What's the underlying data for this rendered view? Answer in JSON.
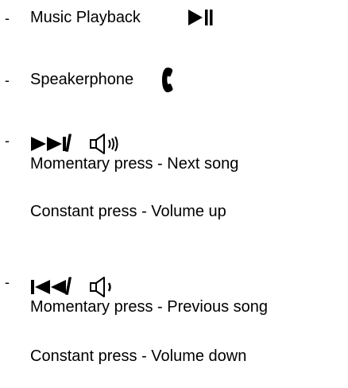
{
  "items": [
    {
      "bullet": "-",
      "label": "Music Playback",
      "icon": "play-pause-icon"
    },
    {
      "bullet": "-",
      "label": "Speakerphone",
      "icon": "phone-handset-icon"
    },
    {
      "bullet": "-",
      "icons": [
        "next-track-icon",
        "volume-up-icon"
      ],
      "separator": "/",
      "lines": [
        "Momentary press - Next song",
        "Constant press - Volume up"
      ]
    },
    {
      "bullet": "-",
      "icons": [
        "previous-track-icon",
        "volume-down-icon"
      ],
      "separator": "/",
      "lines": [
        "Momentary press - Previous song",
        "Constant press - Volume down"
      ]
    }
  ]
}
